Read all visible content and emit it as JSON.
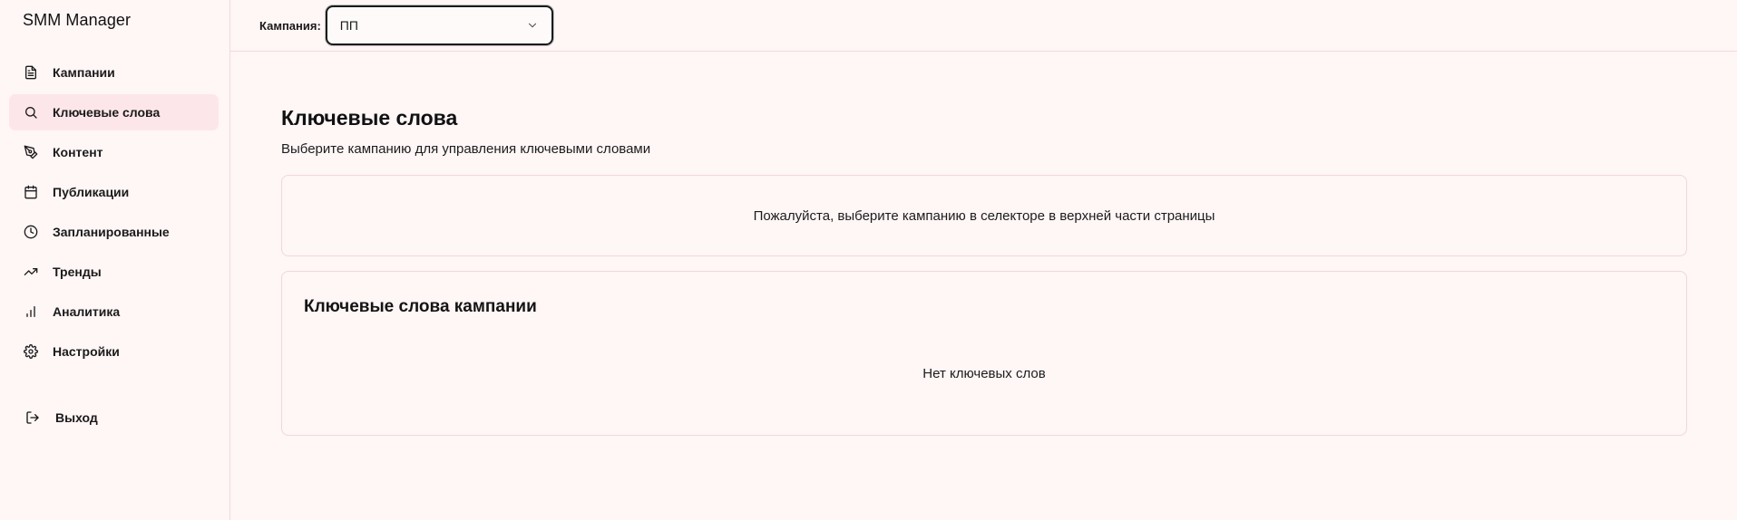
{
  "app": {
    "title": "SMM Manager"
  },
  "sidebar": {
    "items": [
      {
        "label": "Кампании",
        "icon": "document-icon",
        "active": false
      },
      {
        "label": "Ключевые слова",
        "icon": "search-icon",
        "active": true
      },
      {
        "label": "Контент",
        "icon": "pen-icon",
        "active": false
      },
      {
        "label": "Публикации",
        "icon": "calendar-icon",
        "active": false
      },
      {
        "label": "Запланированные",
        "icon": "clock-icon",
        "active": false
      },
      {
        "label": "Тренды",
        "icon": "trending-up-icon",
        "active": false
      },
      {
        "label": "Аналитика",
        "icon": "bar-chart-icon",
        "active": false
      },
      {
        "label": "Настройки",
        "icon": "gear-icon",
        "active": false
      }
    ],
    "logout": {
      "label": "Выход",
      "icon": "logout-icon"
    }
  },
  "topbar": {
    "campaign_label": "Кампания:",
    "campaign_selected": "ПП"
  },
  "page": {
    "title": "Ключевые слова",
    "subtitle": "Выберите кампанию для управления ключевыми словами",
    "notice": "Пожалуйста, выберите кампанию в селекторе в верхней части страницы",
    "keywords_card": {
      "title": "Ключевые слова кампании",
      "empty": "Нет ключевых слов"
    }
  },
  "colors": {
    "background": "#fff6f6",
    "active_item": "#fde6ea",
    "border": "#f0d8db"
  }
}
